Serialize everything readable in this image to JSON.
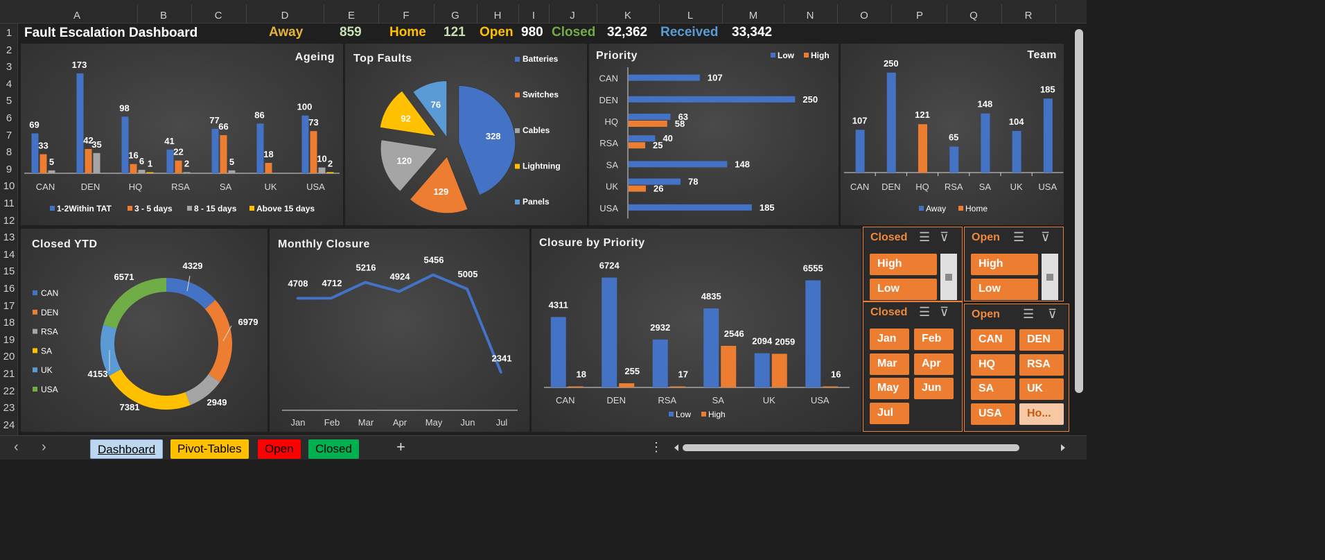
{
  "columns": [
    "A",
    "B",
    "C",
    "D",
    "E",
    "F",
    "G",
    "H",
    "I",
    "J",
    "K",
    "L",
    "M",
    "N",
    "O",
    "P",
    "Q",
    "R"
  ],
  "rows": [
    "1",
    "2",
    "3",
    "4",
    "5",
    "6",
    "7",
    "8",
    "9",
    "10",
    "11",
    "12",
    "13",
    "14",
    "15",
    "16",
    "17",
    "18",
    "19",
    "20",
    "21",
    "22",
    "23",
    "24"
  ],
  "dashboard_title": "Fault Escalation Dashboard",
  "kpis": [
    {
      "label": "Away",
      "value": "859",
      "label_color": "#e6b33a",
      "value_color": "#c6e0b4"
    },
    {
      "label": "Home",
      "value": "121",
      "label_color": "#ffc000",
      "value_color": "#c6e0b4"
    },
    {
      "label": "Open",
      "value": "980",
      "label_color": "#ffc000",
      "value_color": "#ffffff"
    },
    {
      "label": "Closed",
      "value": "32,362",
      "label_color": "#70ad47",
      "value_color": "#ffffff"
    },
    {
      "label": "Received",
      "value": "33,342",
      "label_color": "#5b9bd5",
      "value_color": "#ffffff"
    }
  ],
  "colors": {
    "blue": "#4472c4",
    "orange": "#ed7d31",
    "gray": "#a5a5a5",
    "yellow": "#ffc000",
    "lightblue": "#5b9bd5",
    "green": "#70ad47"
  },
  "chart_data": [
    {
      "id": "ageing",
      "type": "bar",
      "title": "Ageing",
      "categories": [
        "CAN",
        "DEN",
        "HQ",
        "RSA",
        "SA",
        "UK",
        "USA"
      ],
      "series": [
        {
          "name": "1-2Within TAT",
          "values": [
            69,
            173,
            98,
            41,
            77,
            86,
            100
          ]
        },
        {
          "name": "3 - 5 days",
          "values": [
            33,
            42,
            16,
            22,
            66,
            18,
            73
          ]
        },
        {
          "name": "8 - 15 days",
          "values": [
            5,
            35,
            6,
            2,
            5,
            null,
            10
          ]
        },
        {
          "name": "Above 15 days",
          "values": [
            null,
            null,
            1,
            null,
            null,
            null,
            2
          ]
        }
      ],
      "ylim": [
        0,
        180
      ],
      "legend": "bottom"
    },
    {
      "id": "top_faults",
      "type": "pie",
      "title": "Top Faults",
      "slices": [
        {
          "label": "Batteries",
          "value": 328
        },
        {
          "label": "Switches",
          "value": 129
        },
        {
          "label": "Cables",
          "value": 120
        },
        {
          "label": "Lightning",
          "value": 92
        },
        {
          "label": "Panels",
          "value": 76
        }
      ],
      "legend": "right"
    },
    {
      "id": "priority",
      "type": "bar",
      "orientation": "horizontal",
      "title": "Priority",
      "categories": [
        "CAN",
        "DEN",
        "HQ",
        "RSA",
        "SA",
        "UK",
        "USA"
      ],
      "series": [
        {
          "name": "Low",
          "values": [
            107,
            250,
            63,
            40,
            148,
            78,
            185
          ]
        },
        {
          "name": "High",
          "values": [
            null,
            null,
            58,
            25,
            null,
            26,
            null
          ]
        }
      ],
      "xlim": [
        0,
        260
      ],
      "legend": "top-right"
    },
    {
      "id": "team",
      "type": "bar",
      "title": "Team",
      "categories": [
        "CAN",
        "DEN",
        "HQ",
        "RSA",
        "SA",
        "UK",
        "USA"
      ],
      "series": [
        {
          "name": "Away",
          "values": [
            107,
            250,
            null,
            65,
            148,
            104,
            185
          ]
        },
        {
          "name": "Home",
          "values": [
            null,
            null,
            121,
            null,
            null,
            null,
            null
          ]
        }
      ],
      "ylim": [
        0,
        260
      ],
      "legend": "bottom"
    },
    {
      "id": "closed_ytd",
      "type": "pie",
      "variant": "doughnut",
      "title": "Closed YTD",
      "slices": [
        {
          "label": "CAN",
          "value": 4329
        },
        {
          "label": "DEN",
          "value": 6979
        },
        {
          "label": "RSA",
          "value": 2949
        },
        {
          "label": "SA",
          "value": 7381
        },
        {
          "label": "UK",
          "value": 4153
        },
        {
          "label": "USA",
          "value": 6571
        }
      ],
      "legend": "left"
    },
    {
      "id": "monthly_closure",
      "type": "line",
      "title": "Monthly Closure",
      "categories": [
        "Jan",
        "Feb",
        "Mar",
        "Apr",
        "May",
        "Jun",
        "Jul"
      ],
      "series": [
        {
          "values": [
            4708,
            4712,
            5216,
            4924,
            5456,
            5005,
            2341
          ]
        }
      ],
      "ylim": [
        0,
        6000
      ]
    },
    {
      "id": "closure_by_priority",
      "type": "bar",
      "title": "Closure by Priority",
      "categories": [
        "CAN",
        "DEN",
        "RSA",
        "SA",
        "UK",
        "USA"
      ],
      "series": [
        {
          "name": "Low",
          "values": [
            4311,
            6724,
            2932,
            4835,
            2094,
            6555
          ]
        },
        {
          "name": "High",
          "values": [
            18,
            255,
            17,
            2546,
            2059,
            16
          ]
        }
      ],
      "ylim": [
        0,
        7000
      ],
      "legend": "bottom"
    }
  ],
  "slicers": {
    "closed_priority": {
      "title": "Closed",
      "items": [
        "High",
        "Low"
      ]
    },
    "open_priority": {
      "title": "Open",
      "items": [
        "High",
        "Low"
      ]
    },
    "closed_month": {
      "title": "Closed",
      "items": [
        "Jan",
        "Feb",
        "Mar",
        "Apr",
        "May",
        "Jun",
        "Jul"
      ]
    },
    "open_team": {
      "title": "Open",
      "items": [
        "CAN",
        "DEN",
        "HQ",
        "RSA",
        "SA",
        "UK",
        "USA",
        "Ho..."
      ]
    }
  },
  "tabs": [
    {
      "label": "Dashboard",
      "bg": "#bdd7ee",
      "active": true
    },
    {
      "label": "Pivot-Tables",
      "bg": "#ffc000"
    },
    {
      "label": "Open",
      "bg": "#ff0000"
    },
    {
      "label": "Closed",
      "bg": "#00b050"
    }
  ],
  "icons": {
    "prev": "chevron-left-icon",
    "next": "chevron-right-icon",
    "add": "plus-icon",
    "more": "more-vertical-icon",
    "multiselect": "multi-select-icon",
    "clear_filter": "clear-filter-icon"
  }
}
